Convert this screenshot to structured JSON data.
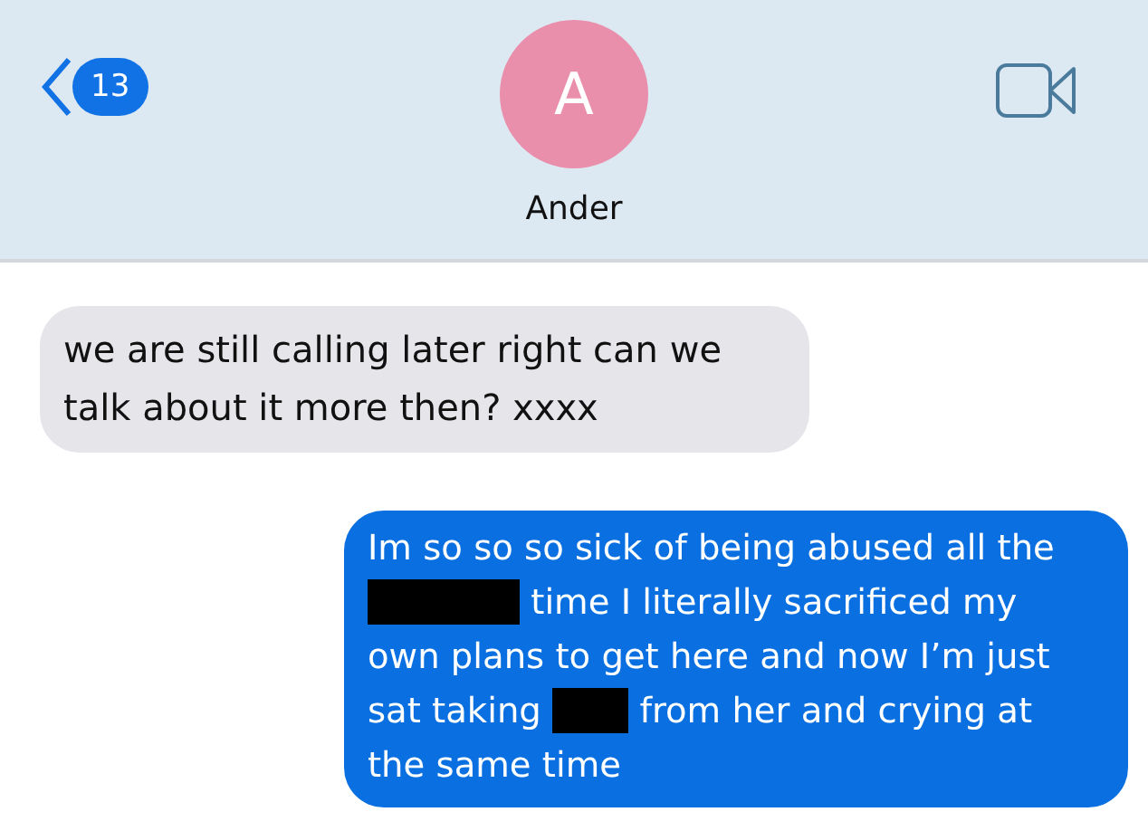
{
  "header": {
    "back_badge": "13",
    "contact_initial": "A",
    "contact_name": "Ander"
  },
  "messages": [
    {
      "kind": "received",
      "parts": [
        {
          "kind": "text",
          "text": "we are still calling later right can we talk about it more then? xxxx"
        }
      ]
    },
    {
      "kind": "sent",
      "parts": [
        {
          "kind": "text",
          "text": "Im so so so sick of being abused all the"
        },
        {
          "kind": "redaction"
        },
        {
          "kind": "text",
          "text": "time I literally sacrificed my own plans to get here and now I’m just sat taking"
        },
        {
          "kind": "redaction"
        },
        {
          "kind": "text",
          "text": "from her and crying at the same time"
        }
      ]
    }
  ]
}
